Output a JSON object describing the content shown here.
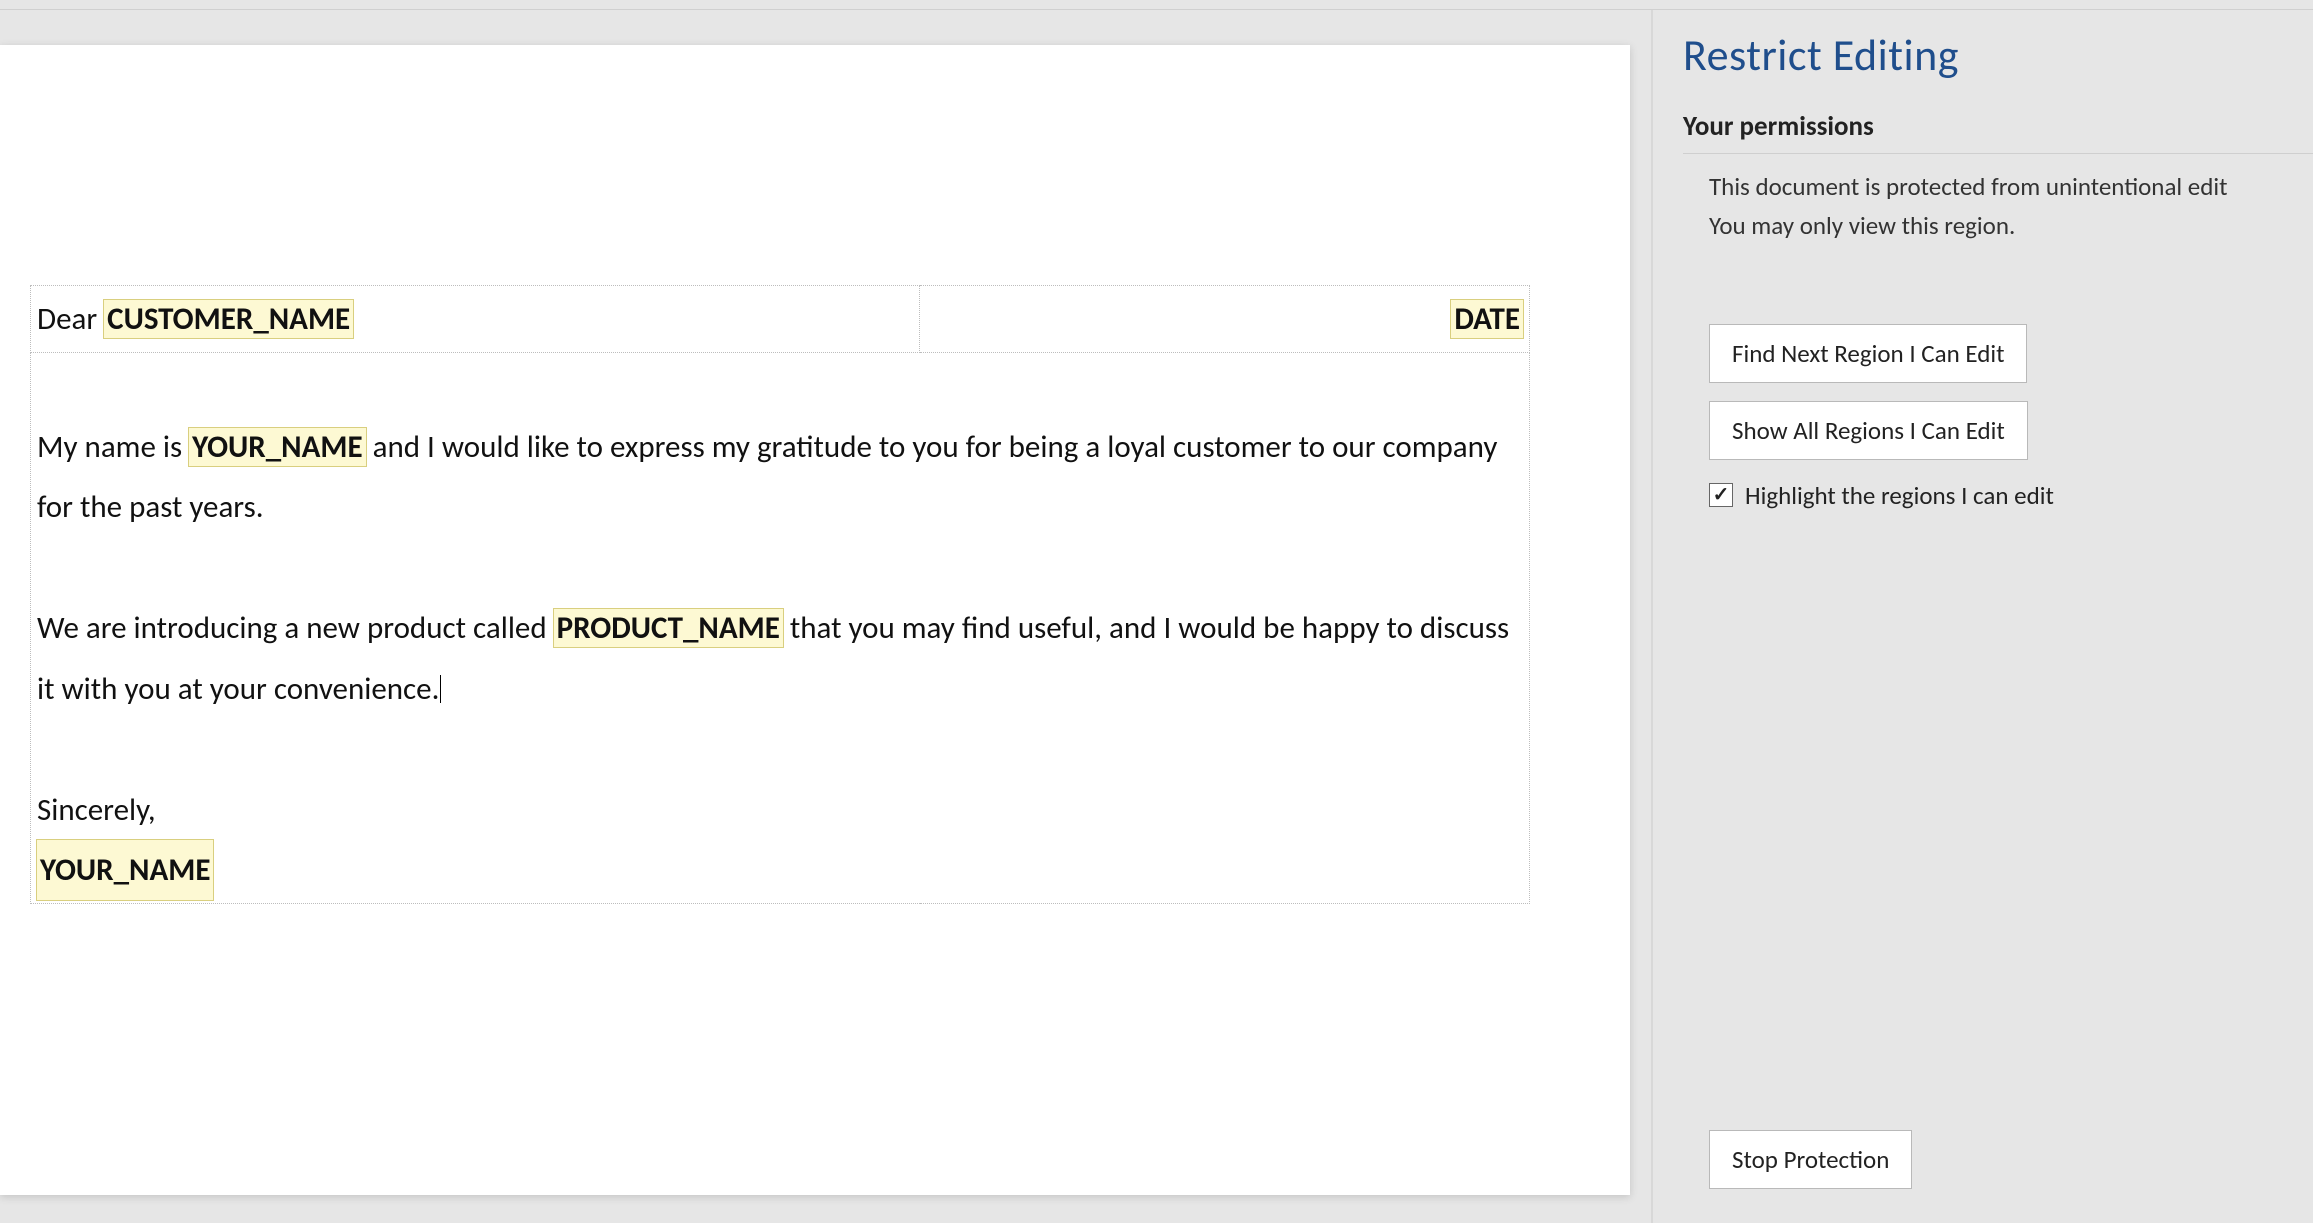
{
  "document": {
    "greeting_prefix": "Dear ",
    "fields": {
      "customer_name": "CUSTOMER_NAME",
      "date": "DATE",
      "your_name": "YOUR_NAME",
      "product_name": "PRODUCT_NAME",
      "signature_name": "YOUR_NAME"
    },
    "body": {
      "para1_before": "My name is ",
      "para1_after": " and I would like to express my gratitude to you for being a loyal customer to our company for the past years.",
      "para2_before": "We are introducing a new product called ",
      "para2_after": " that you may find useful, and I would be happy to discuss it with you at your convenience.",
      "closing": "Sincerely,"
    }
  },
  "pane": {
    "title": "Restrict Editing",
    "permissions_header": "Your permissions",
    "permissions_line1": "This document is protected from unintentional edit",
    "permissions_line2": "You may only view this region.",
    "find_next_btn": "Find Next Region I Can Edit",
    "show_all_btn": "Show All Regions I Can Edit",
    "highlight_chk_label": "Highlight the regions I can edit",
    "highlight_checked": true,
    "stop_btn": "Stop Protection"
  }
}
